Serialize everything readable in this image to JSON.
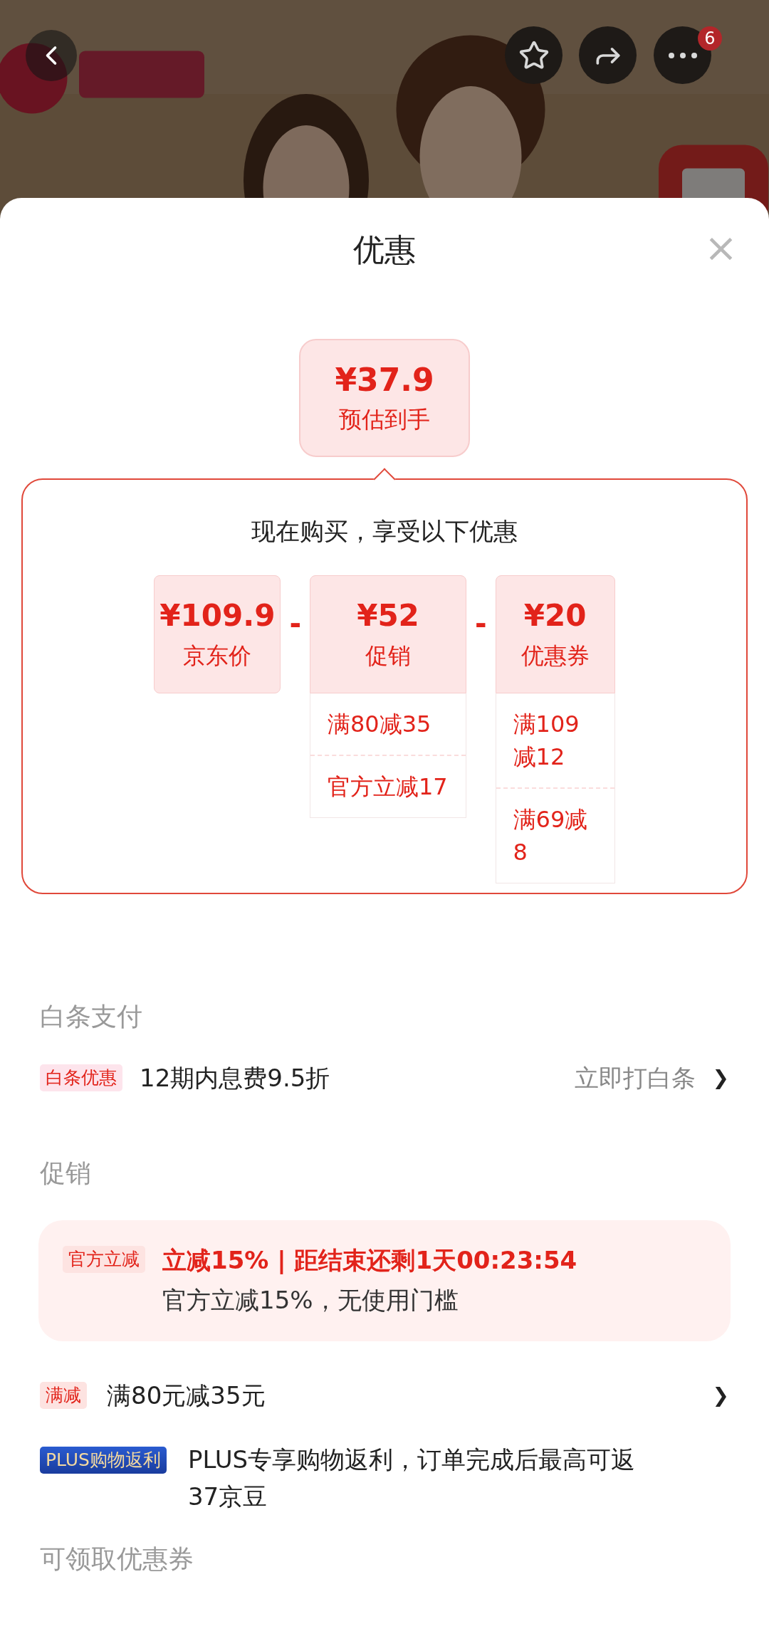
{
  "header": {
    "badge_count": "6"
  },
  "sheet": {
    "title": "优惠",
    "close": "×"
  },
  "estimate": {
    "price": "¥37.9",
    "label": "预估到手"
  },
  "breakdown": {
    "heading": "现在购买，享受以下优惠",
    "operator": "-",
    "items": [
      {
        "amount": "¥109.9",
        "label": "京东价"
      },
      {
        "amount": "¥52",
        "label": "促销",
        "details": [
          "满80减35",
          "官方立减17"
        ]
      },
      {
        "amount": "¥20",
        "label": "优惠券",
        "details": [
          "满109减12",
          "满69减8"
        ]
      }
    ]
  },
  "baitiao": {
    "heading": "白条支付",
    "tag": "白条优惠",
    "text": "12期内息费9.5折",
    "action": "立即打白条",
    "chevron": "❯"
  },
  "promotions": {
    "heading": "促销",
    "items": [
      {
        "kind": "highlight",
        "tag": "官方立减",
        "title": "立减15% | 距结束还剩1天00:23:54",
        "text": "官方立减15%，无使用门槛"
      },
      {
        "kind": "plain",
        "tag": "满减",
        "text": "满80元减35元",
        "chevron": "❯"
      },
      {
        "kind": "plus",
        "tag": "PLUS购物返利",
        "text": "PLUS专享购物返利，订单完成后最高可返37京豆"
      }
    ]
  },
  "coupons": {
    "heading": "可领取优惠券"
  }
}
